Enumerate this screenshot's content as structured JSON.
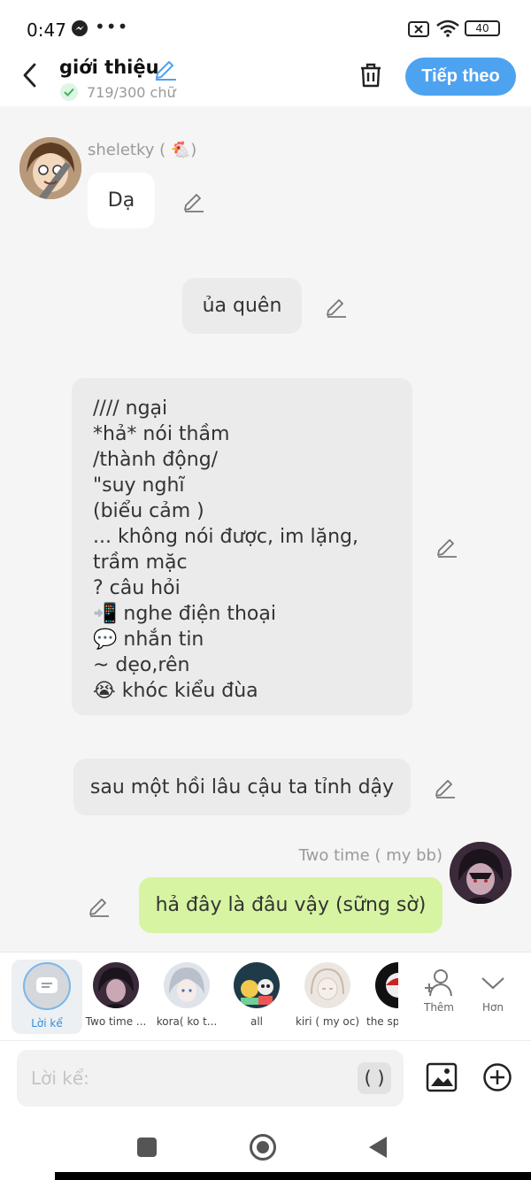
{
  "status_bar": {
    "time": "0:47",
    "more": "•••",
    "battery": "40"
  },
  "header": {
    "title": "giới thiệu",
    "word_count": "719/300 chữ",
    "next_button": "Tiếp theo"
  },
  "messages": [
    {
      "speaker": "sheletky ( 🐔)",
      "text": "Dạ",
      "style": "white"
    },
    {
      "text": "ủa quên",
      "style": "grey"
    },
    {
      "lines": [
        "////  ngại",
        "*hả* nói thầm",
        "/thành động/",
        "\"suy nghĩ",
        "(biểu cảm )",
        "... không nói được, im lặng,",
        "trầm mặc",
        "? câu hỏi",
        "📲 nghe điện thoại",
        "💬 nhắn tin",
        "~ dẹo,rên",
        "😭 khóc kiểu đùa"
      ],
      "style": "grey"
    },
    {
      "text": "sau một hồi lâu cậu ta tỉnh dậy",
      "style": "grey"
    },
    {
      "speaker": "Two time ( my bb)",
      "text": "hả đây là đâu vậy (sững sờ)",
      "style": "green"
    }
  ],
  "characters": [
    {
      "label": "Lời kể",
      "selected": true
    },
    {
      "label": "Two time ..."
    },
    {
      "label": "kora( ko t..."
    },
    {
      "label": "all"
    },
    {
      "label": "kiri ( my oc)"
    },
    {
      "label": "the sp"
    }
  ],
  "strip_actions": {
    "add": "Thêm",
    "more": "Hơn"
  },
  "input": {
    "placeholder": "Lời kể:",
    "paren": "( )"
  },
  "colors": {
    "accent": "#4da3f0",
    "green_bubble": "#d6f4a2",
    "grey_bubble": "#ebebeb"
  }
}
